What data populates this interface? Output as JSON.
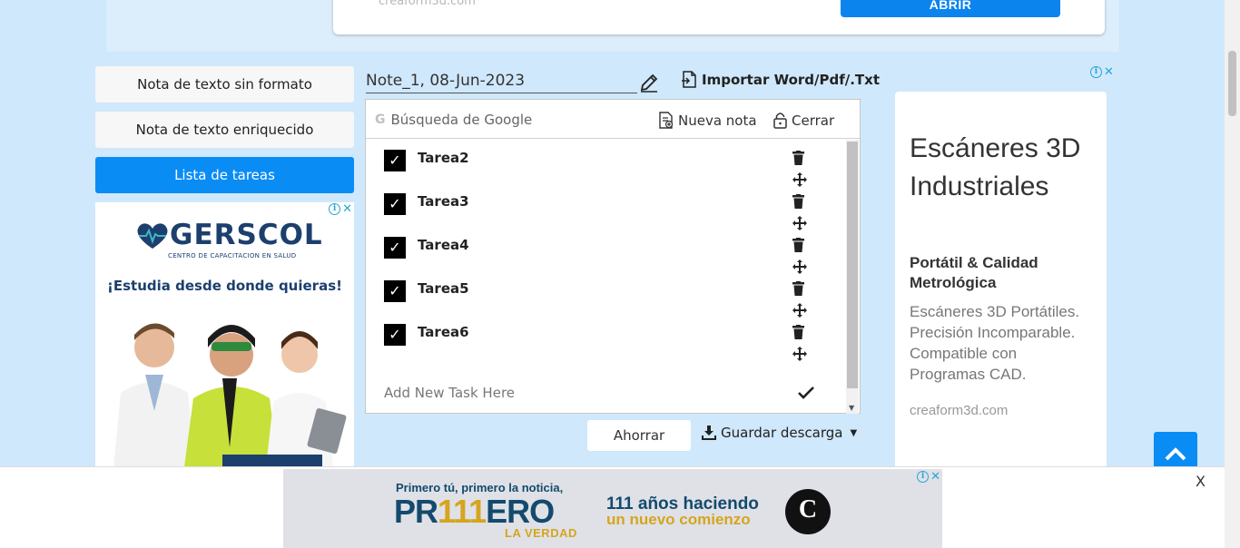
{
  "top_ad": {
    "url": "creaform3d.com",
    "button_label": "ABRIR"
  },
  "sidebar": {
    "items": [
      {
        "label": "Nota de texto sin formato",
        "active": false
      },
      {
        "label": "Nota de texto enriquecido",
        "active": false
      },
      {
        "label": "Lista de tareas",
        "active": true
      }
    ]
  },
  "left_ad": {
    "brand": "GERSCOL",
    "brand_sub": "CENTRO DE CAPACITACION EN SALUD",
    "tagline": "¡Estudia desde donde quieras!"
  },
  "editor": {
    "note_title": "Note_1, 08-Jun-2023",
    "import_label": "Importar Word/Pdf/.Txt",
    "search_label": "Búsqueda de Google",
    "new_note_label": "Nueva nota",
    "close_label": "Cerrar",
    "tasks": [
      {
        "name": "Tarea2",
        "checked": true
      },
      {
        "name": "Tarea3",
        "checked": true
      },
      {
        "name": "Tarea4",
        "checked": true
      },
      {
        "name": "Tarea5",
        "checked": true
      },
      {
        "name": "Tarea6",
        "checked": true
      }
    ],
    "add_task_placeholder": "Add New Task Here",
    "save_label": "Ahorrar",
    "download_label": "Guardar descarga"
  },
  "right_ad": {
    "title": "Escáneres 3D Industriales",
    "subtitle": "Portátil & Calidad Metrológica",
    "description": "Escáneres 3D Portátiles. Precisión Incomparable. Compatible con Programas CAD.",
    "url": "creaform3d.com"
  },
  "bottom_ad": {
    "line1": "Primero tú, primero la noticia,",
    "logo_pre": "PR",
    "logo_mid": "111",
    "logo_post": "ERO",
    "logo_sub": "LA VERDAD",
    "right_line1": "111 años haciendo",
    "right_line2": "un nuevo comienzo",
    "circle_letter": "C",
    "close_label": "X"
  },
  "colors": {
    "background": "#cfe8fb",
    "accent": "#0a8cf5",
    "ad_navy": "#134a6d",
    "ad_gold": "#d5a51f"
  }
}
